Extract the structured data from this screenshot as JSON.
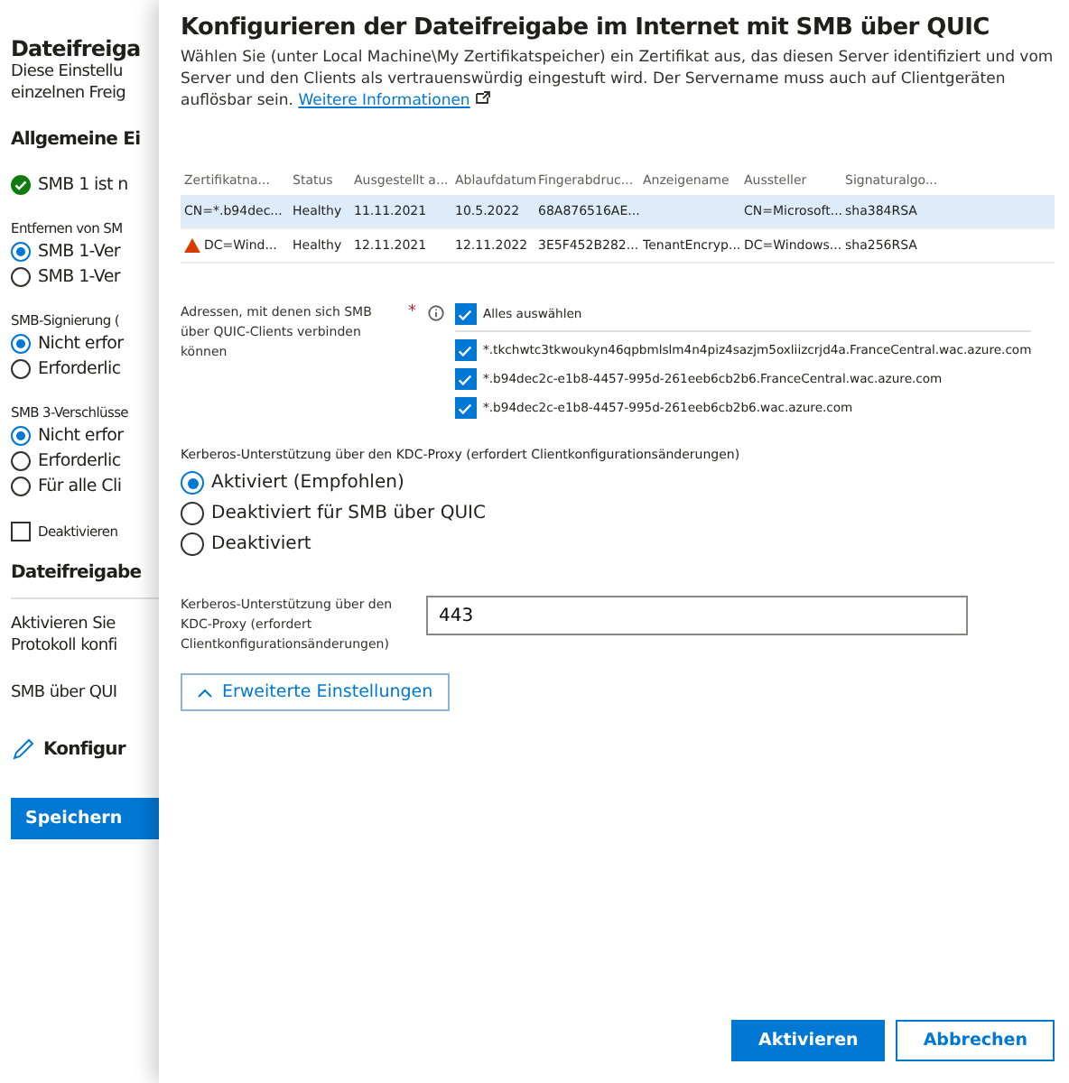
{
  "background": {
    "title": "Dateifreiga",
    "description": [
      "Diese Einstellu",
      "einzelnen Freig"
    ],
    "section_title": "Allgemeine Ei",
    "status": "SMB 1 ist n",
    "groups": [
      {
        "label": "Entfernen von SM",
        "options": [
          {
            "label": "SMB 1-Ver",
            "selected": true
          },
          {
            "label": "SMB 1-Ver",
            "selected": false
          }
        ]
      },
      {
        "label": "SMB-Signierung (",
        "options": [
          {
            "label": "Nicht erfor",
            "selected": true
          },
          {
            "label": "Erforderlic",
            "selected": false
          }
        ]
      },
      {
        "label": "SMB 3-Verschlüsse",
        "options": [
          {
            "label": "Nicht erfor",
            "selected": true
          },
          {
            "label": "Erforderlic",
            "selected": false
          },
          {
            "label": "Für alle Cli",
            "selected": false
          }
        ]
      }
    ],
    "checkbox": {
      "label": "Deaktivieren",
      "checked": false
    },
    "section2_title": "Dateifreigabe",
    "section2_text": [
      "Aktivieren Sie",
      "Protokoll konfi"
    ],
    "smb_quic": "SMB über QUI",
    "configure": "Konfigur",
    "save": "Speichern"
  },
  "panel": {
    "title": "Konfigurieren der Dateifreigabe im Internet mit SMB über QUIC",
    "description": "Wählen Sie (unter Local Machine\\My Zertifikatspeicher) ein Zertifikat aus, das diesen Server identifiziert und vom Server und den Clients als vertrauenswürdig eingestuft wird. Der Servername muss auch auf Clientgeräten auflösbar sein.",
    "link": "Weitere Informationen",
    "table": {
      "columns": [
        "Zertifikatna...",
        "Status",
        "Ausgestellt a...",
        "Ablaufdatum",
        "Fingerabdruc...",
        "Anzeigename",
        "Aussteller",
        "Signaturalgo..."
      ],
      "rows": [
        {
          "selected": true,
          "warning": false,
          "cells": [
            "CN=*.b94dec...",
            "Healthy",
            "11.11.2021",
            "10.5.2022",
            "68A876516AE...",
            "",
            "CN=Microsoft...",
            "sha384RSA"
          ]
        },
        {
          "selected": false,
          "warning": true,
          "cells": [
            "DC=Wind...",
            "Healthy",
            "12.11.2021",
            "12.11.2022",
            "3E5F452B282...",
            "TenantEncryp...",
            "DC=Windows...",
            "sha256RSA"
          ]
        }
      ]
    },
    "addresses": {
      "label": "Adressen, mit denen sich SMB über QUIC-Clients verbinden können",
      "required": "*",
      "items": [
        {
          "label": "Alles auswählen",
          "checked": true
        },
        {
          "label": "*.tkchwtc3tkwoukyn46qpbmlslm4n4piz4sazjm5oxliizcrjd4a.FranceCentral.wac.azure.com",
          "checked": true
        },
        {
          "label": "*.b94dec2c-e1b8-4457-995d-261eeb6cb2b6.FranceCentral.wac.azure.com",
          "checked": true
        },
        {
          "label": "*.b94dec2c-e1b8-4457-995d-261eeb6cb2b6.wac.azure.com",
          "checked": true
        }
      ]
    },
    "kerberos": {
      "label": "Kerberos-Unterstützung über den KDC-Proxy (erfordert Clientkonfigurationsänderungen)",
      "options": [
        {
          "label": "Aktiviert (Empfohlen)",
          "selected": true
        },
        {
          "label": "Deaktiviert für SMB über QUIC",
          "selected": false
        },
        {
          "label": "Deaktiviert",
          "selected": false
        }
      ]
    },
    "port": {
      "label": "Kerberos-Unterstützung über den KDC-Proxy (erfordert Clientkonfigurationsänderungen)",
      "value": "443"
    },
    "advanced": {
      "label": "Erweiterte Einstellungen",
      "expanded": true
    },
    "buttons": [
      {
        "label": "Aktivieren",
        "kind": "primary"
      },
      {
        "label": "Abbrechen",
        "kind": "secondary"
      }
    ]
  }
}
